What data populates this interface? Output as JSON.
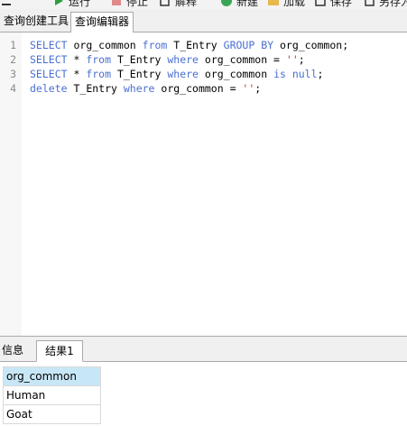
{
  "toolbar": {
    "items": [
      {
        "label": "运行",
        "icon": "run-icon",
        "color": "#2e9e3e"
      },
      {
        "label": "停止",
        "icon": "stop-icon",
        "color": "#d05050"
      },
      {
        "label": "解释",
        "icon": "explain-icon",
        "color": "#333333"
      },
      {
        "label": "新建",
        "icon": "new-icon",
        "color": "#3aa655"
      },
      {
        "label": "加载",
        "icon": "load-icon",
        "color": "#e8b84a"
      },
      {
        "label": "保存",
        "icon": "save-icon",
        "color": "#333333"
      },
      {
        "label": "另存为",
        "icon": "save-as-icon",
        "color": "#333333"
      }
    ]
  },
  "top_tabs": [
    {
      "label": "查询创建工具",
      "active": false
    },
    {
      "label": "查询编辑器",
      "active": true
    }
  ],
  "editor": {
    "lines": [
      {
        "num": "1",
        "tokens": [
          {
            "t": "SELECT",
            "c": "kw"
          },
          {
            "t": " org_common ",
            "c": "plain"
          },
          {
            "t": "from",
            "c": "kw"
          },
          {
            "t": " T_Entry ",
            "c": "plain"
          },
          {
            "t": "GROUP BY",
            "c": "kw"
          },
          {
            "t": " org_common;",
            "c": "plain"
          }
        ]
      },
      {
        "num": "2",
        "tokens": [
          {
            "t": "SELECT",
            "c": "kw"
          },
          {
            "t": " * ",
            "c": "plain"
          },
          {
            "t": "from",
            "c": "kw"
          },
          {
            "t": " T_Entry ",
            "c": "plain"
          },
          {
            "t": "where",
            "c": "kw"
          },
          {
            "t": " org_common = ",
            "c": "plain"
          },
          {
            "t": "''",
            "c": "str"
          },
          {
            "t": ";",
            "c": "plain"
          }
        ]
      },
      {
        "num": "3",
        "tokens": [
          {
            "t": "SELECT",
            "c": "kw"
          },
          {
            "t": " * ",
            "c": "plain"
          },
          {
            "t": "from",
            "c": "kw"
          },
          {
            "t": " T_Entry ",
            "c": "plain"
          },
          {
            "t": "where",
            "c": "kw"
          },
          {
            "t": " org_common ",
            "c": "plain"
          },
          {
            "t": "is null",
            "c": "kw"
          },
          {
            "t": ";",
            "c": "plain"
          }
        ]
      },
      {
        "num": "4",
        "tokens": [
          {
            "t": "delete",
            "c": "kw"
          },
          {
            "t": " T_Entry ",
            "c": "plain"
          },
          {
            "t": "where",
            "c": "kw"
          },
          {
            "t": " org_common = ",
            "c": "plain"
          },
          {
            "t": "''",
            "c": "str"
          },
          {
            "t": ";",
            "c": "plain"
          }
        ]
      }
    ]
  },
  "bottom_tabs": [
    {
      "label": "信息",
      "active": false
    },
    {
      "label": "结果1",
      "active": true
    }
  ],
  "results": {
    "columns": [
      "org_common"
    ],
    "rows": [
      [
        "Human"
      ],
      [
        "Goat"
      ]
    ]
  },
  "colors": {
    "keyword": "#4a6fd3",
    "string": "#c0392b",
    "header_highlight": "#c8e7f6"
  }
}
